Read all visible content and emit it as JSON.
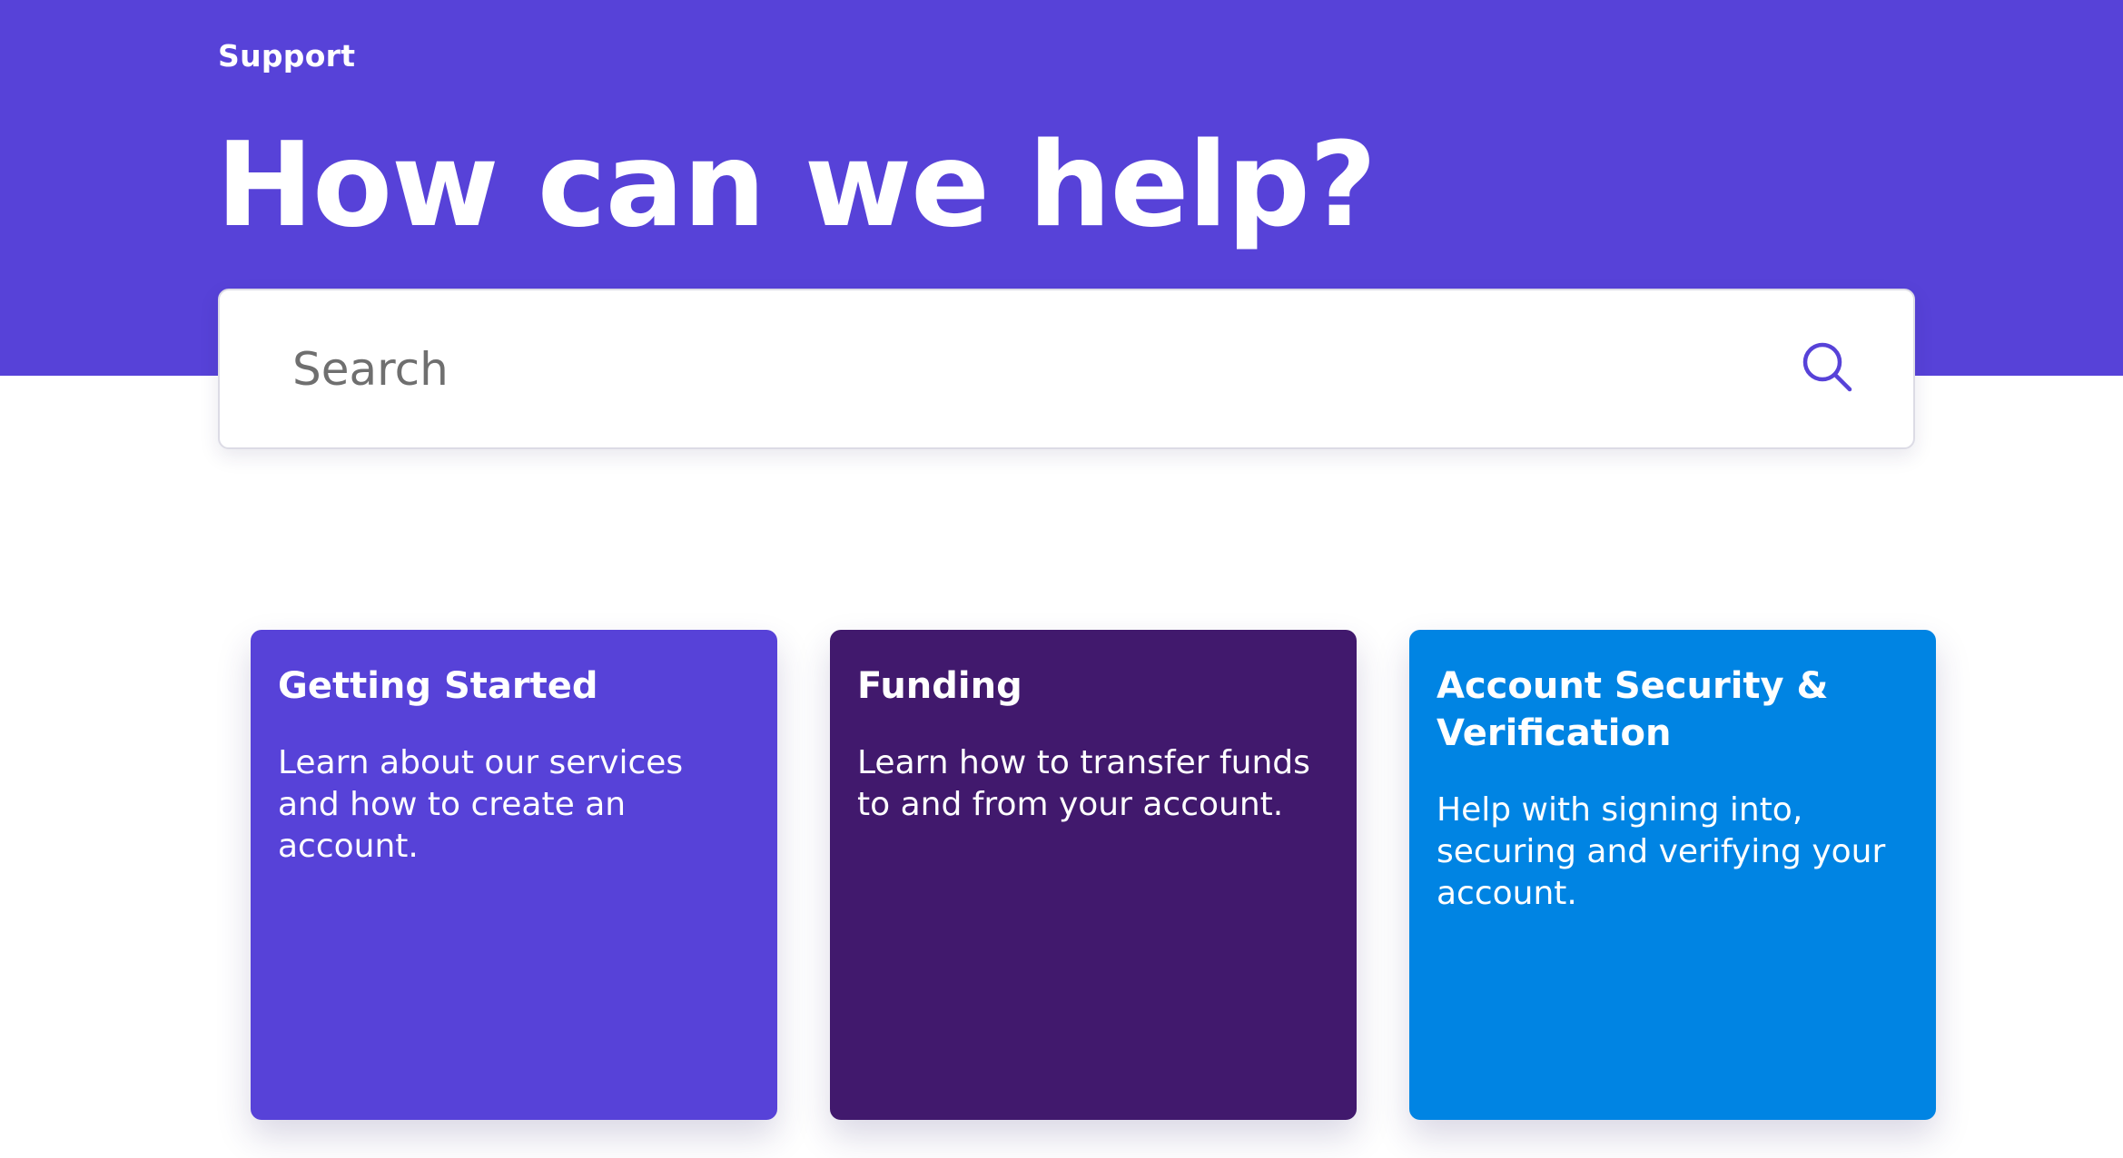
{
  "header": {
    "eyebrow": "Support",
    "title": "How can we help?"
  },
  "search": {
    "placeholder": "Search",
    "value": "",
    "icon": "search-icon"
  },
  "cards": [
    {
      "title": "Getting Started",
      "description": "Learn about our services and how to create an account.",
      "color": "#5742d8"
    },
    {
      "title": "Funding",
      "description": "Learn how to transfer funds to and from your account.",
      "color": "#41196d"
    },
    {
      "title": "Account Security & Verification",
      "description": "Help with signing into, securing and verifying your account.",
      "color": "#0084e3"
    }
  ],
  "colors": {
    "hero_background": "#5742d8",
    "search_icon": "#5742d8"
  }
}
